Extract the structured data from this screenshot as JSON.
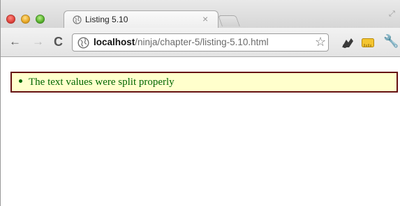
{
  "window": {
    "tab_title": "Listing 5.10",
    "tab_close_glyph": "×"
  },
  "toolbar": {
    "back_glyph": "←",
    "forward_glyph": "→",
    "reload_glyph": "C",
    "url_host": "localhost",
    "url_path": "/ninja/chapter-5/listing-5.10.html",
    "star_glyph": "☆",
    "wrench_glyph": "🔧"
  },
  "results": {
    "items": [
      "The text values were split properly"
    ],
    "pass_color": "#006600",
    "background": "#ffffcc",
    "border_color": "#661111"
  }
}
